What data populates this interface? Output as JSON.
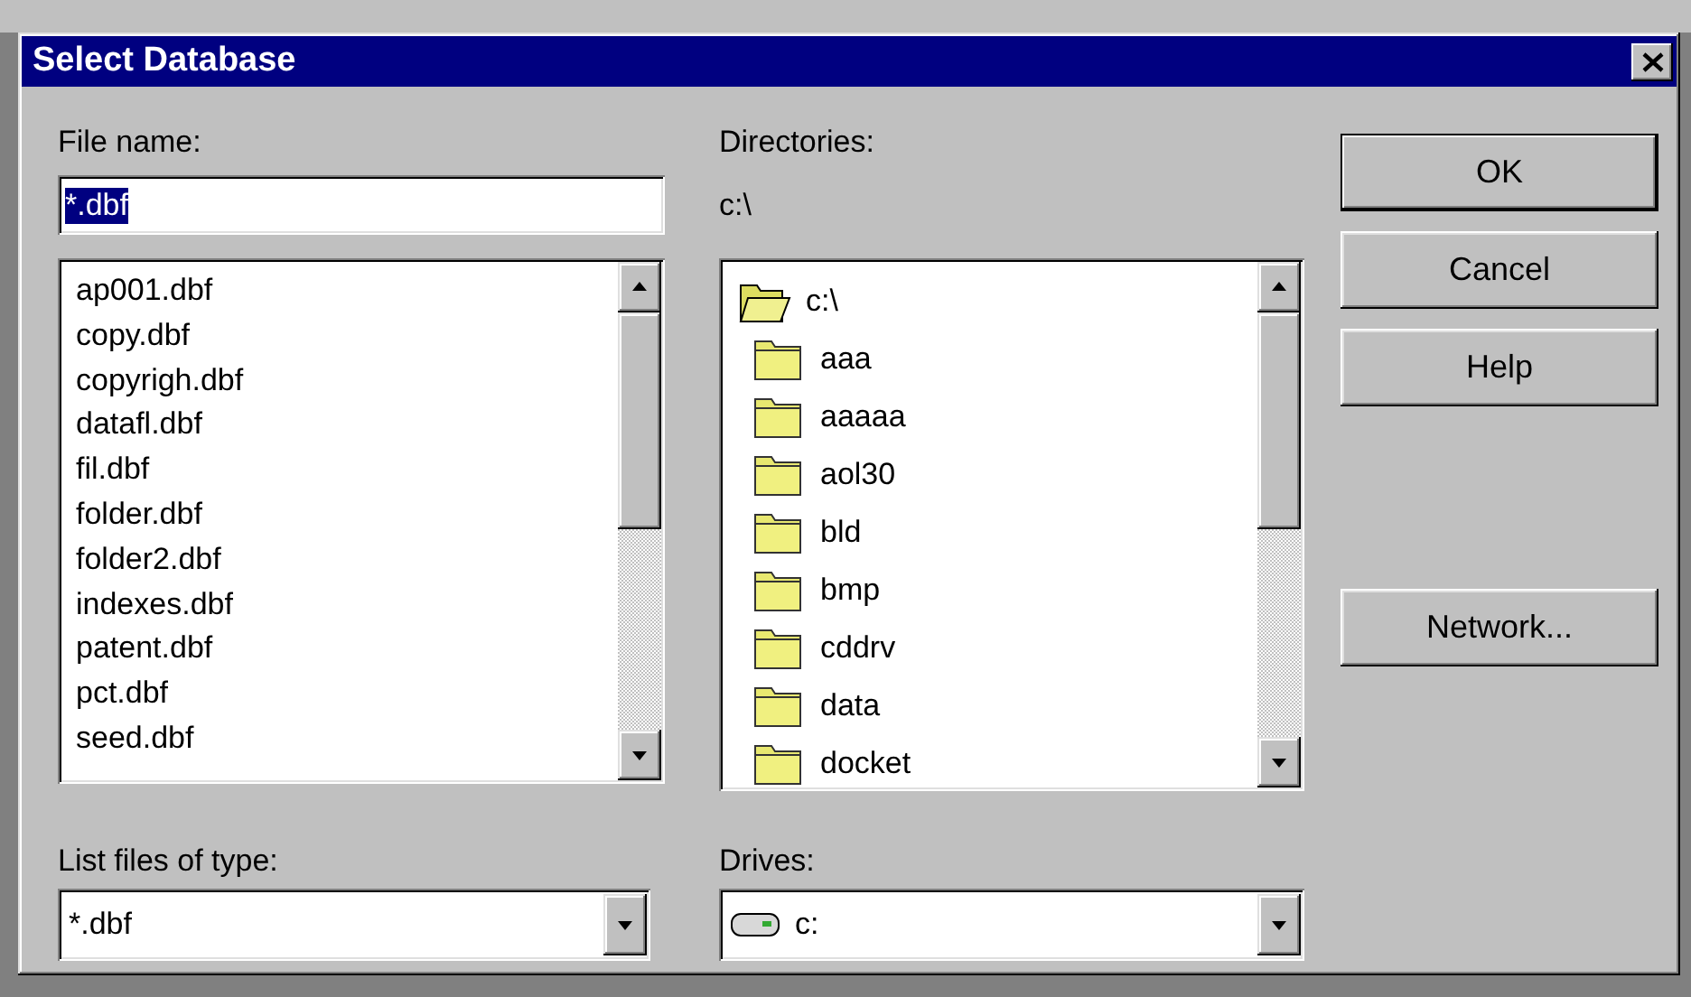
{
  "window": {
    "title": "Select Database"
  },
  "file_name": {
    "label": "File name:",
    "value": "*.dbf",
    "value_selected": true
  },
  "files": [
    "ap001.dbf",
    "copy.dbf",
    "copyrigh.dbf",
    "datafl.dbf",
    "fil.dbf",
    "folder.dbf",
    "folder2.dbf",
    "indexes.dbf",
    "patent.dbf",
    "pct.dbf",
    "seed.dbf"
  ],
  "directories": {
    "label": "Directories:",
    "path": "c:\\",
    "items": [
      {
        "name": "c:\\",
        "kind": "open"
      },
      {
        "name": "aaa",
        "kind": "closed"
      },
      {
        "name": "aaaaa",
        "kind": "closed"
      },
      {
        "name": "aol30",
        "kind": "closed"
      },
      {
        "name": "bld",
        "kind": "closed"
      },
      {
        "name": "bmp",
        "kind": "closed"
      },
      {
        "name": "cddrv",
        "kind": "closed"
      },
      {
        "name": "data",
        "kind": "closed"
      },
      {
        "name": "docket",
        "kind": "closed"
      }
    ]
  },
  "buttons": [
    {
      "label": "OK",
      "default": true
    },
    {
      "label": "Cancel",
      "default": false
    },
    {
      "label": "Help",
      "default": false
    }
  ],
  "network_button": {
    "label": "Network...",
    "default": false
  },
  "file_type": {
    "label": "List files of type:",
    "value": "*.dbf"
  },
  "drives": {
    "label": "Drives:",
    "value": "c:"
  }
}
